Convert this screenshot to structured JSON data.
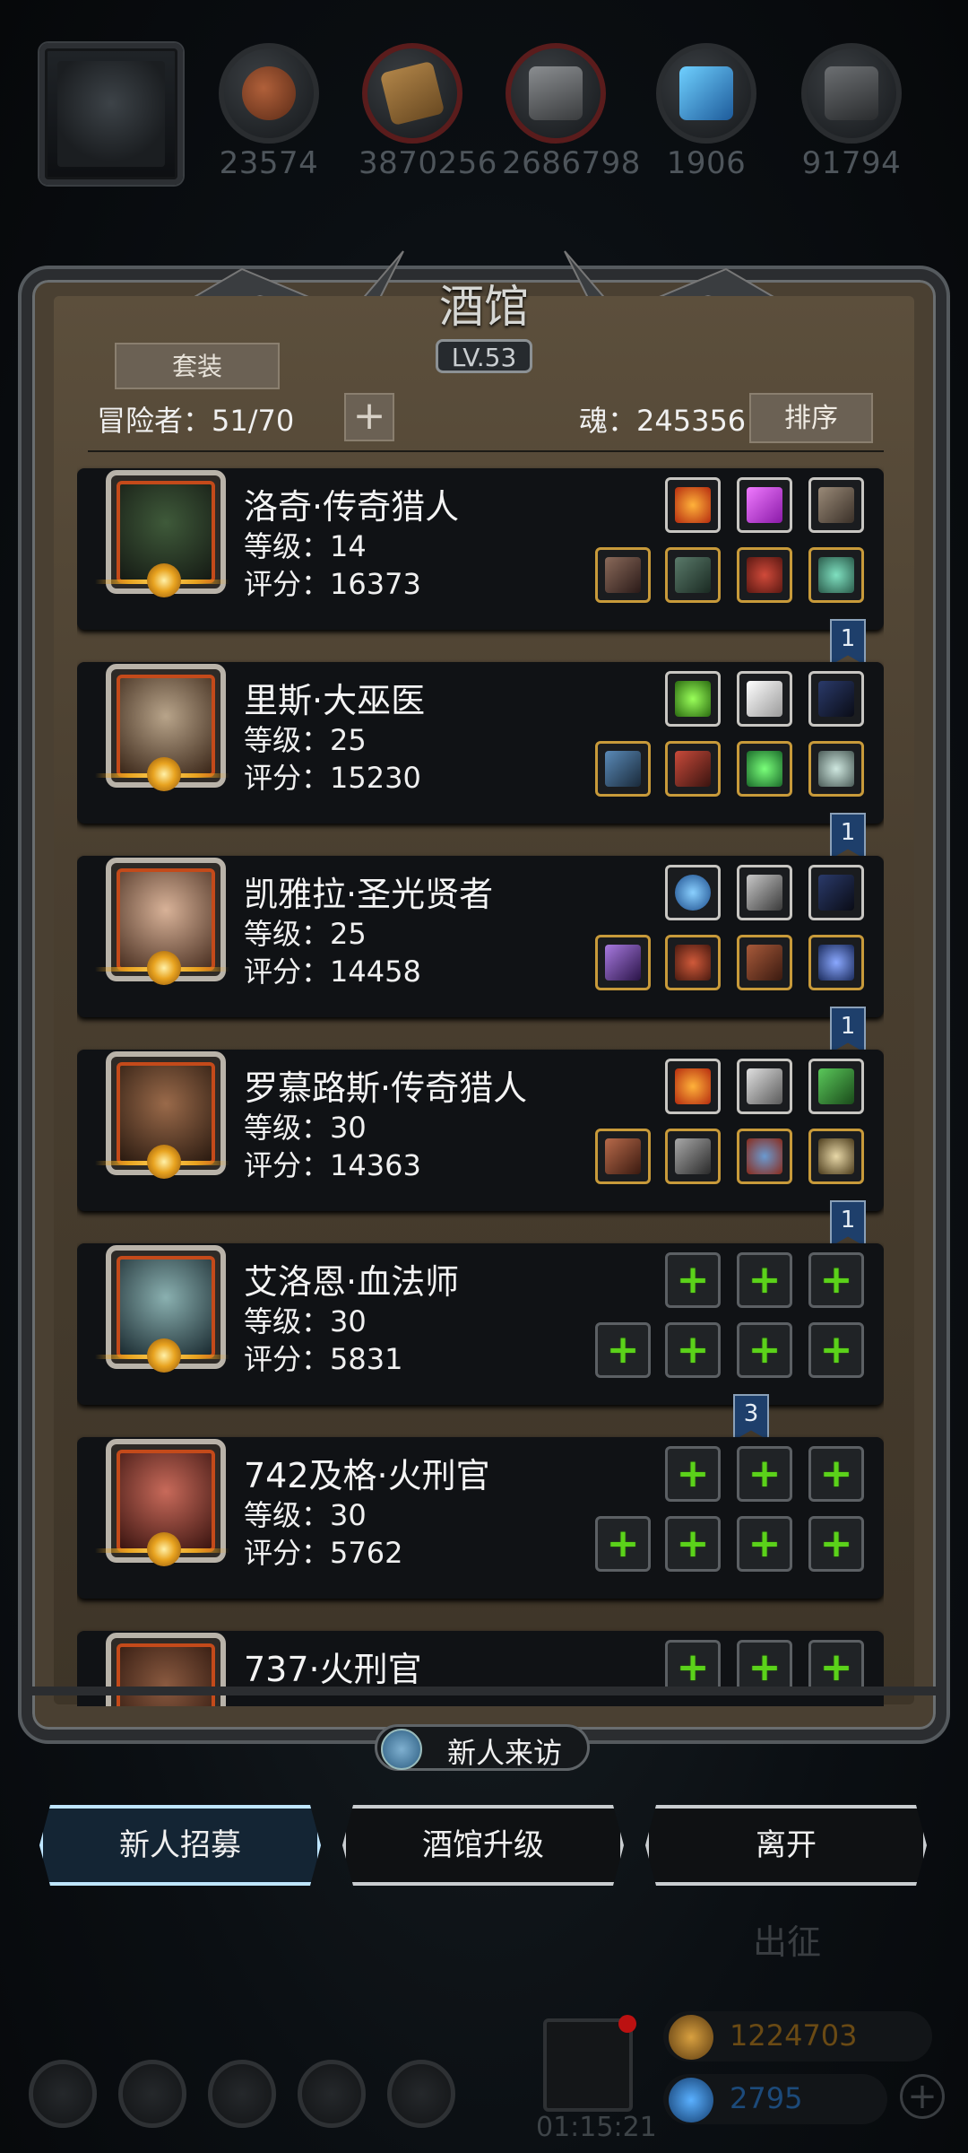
{
  "resources": [
    {
      "name": "hide-leather",
      "value": "23574",
      "color": "#7a3f22"
    },
    {
      "name": "wood",
      "value": "3870256",
      "color": "#8a6a3a"
    },
    {
      "name": "iron",
      "value": "2686798",
      "color": "#5c5f62"
    },
    {
      "name": "crystal",
      "value": "1906",
      "color": "#2b6aa8"
    },
    {
      "name": "ore",
      "value": "91794",
      "color": "#404346"
    }
  ],
  "panel": {
    "title": "酒馆",
    "level": "LV.53",
    "suit_button": "套装",
    "adventurers": "冒险者：51/70",
    "add_button": "+",
    "soul": "魂：245356",
    "sort_button": "排序"
  },
  "heroes": [
    {
      "name": "洛奇·传奇猎人",
      "level": "等级：14",
      "score": "评分：16373",
      "portrait_color": "#243026"
    },
    {
      "name": "里斯·大巫医",
      "level": "等级：25",
      "score": "评分：15230",
      "portrait_color": "#5a3a22"
    },
    {
      "name": "凯雅拉·圣光贤者",
      "level": "等级：25",
      "score": "评分：14458",
      "portrait_color": "#6a4a38"
    },
    {
      "name": "罗慕路斯·传奇猎人",
      "level": "等级：30",
      "score": "评分：14363",
      "portrait_color": "#4a3020"
    },
    {
      "name": "艾洛恩·血法师",
      "level": "等级：30",
      "score": "评分：5831",
      "portrait_color": "#26384a"
    },
    {
      "name": "742及格·火刑官",
      "level": "等级：30",
      "score": "评分：5762",
      "portrait_color": "#6a2a22"
    },
    {
      "name": "737·火刑官",
      "level": "",
      "score": "",
      "portrait_color": "#4a2a1e"
    }
  ],
  "flags": [
    "1",
    "1",
    "1",
    "1",
    "3"
  ],
  "visit_button": "新人来访",
  "actions": {
    "recruit": "新人招募",
    "upgrade": "酒馆升级",
    "leave": "离开"
  },
  "expedition": "出征",
  "timer": "01:15:21",
  "currencies": [
    {
      "name": "gold",
      "value": "1224703",
      "color": "#6a4a14"
    },
    {
      "name": "gem",
      "value": "2795",
      "color": "#1c4a7a"
    }
  ],
  "add_currency": "+"
}
